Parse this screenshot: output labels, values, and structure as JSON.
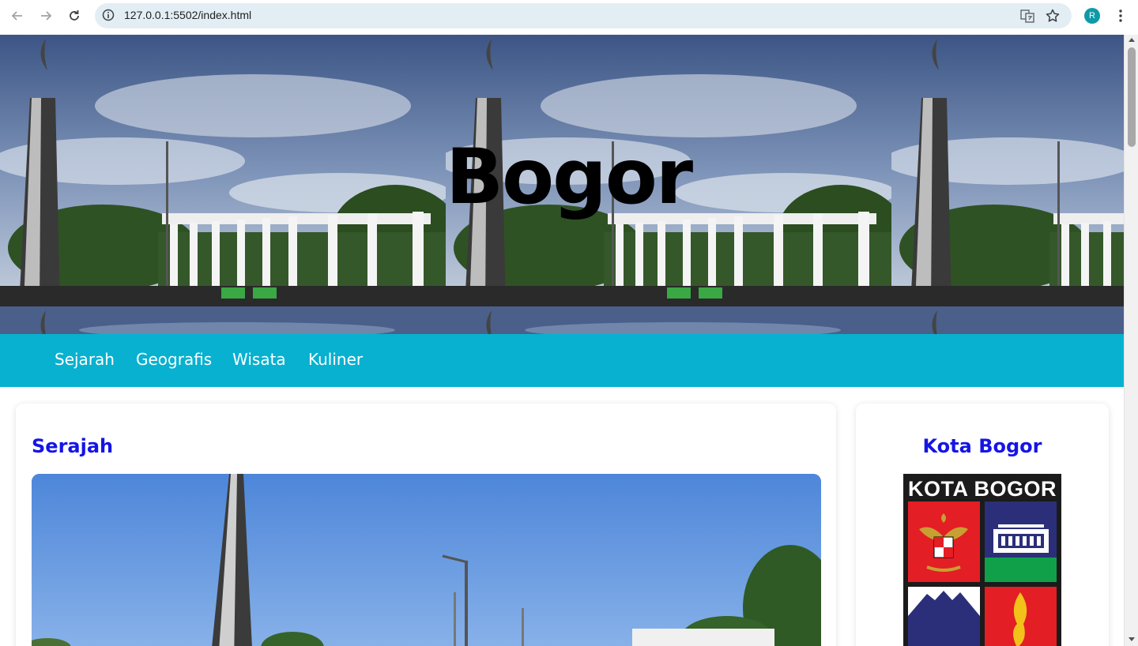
{
  "browser": {
    "url": "127.0.0.1:5502/index.html",
    "profile_initial": "R"
  },
  "hero": {
    "title": "Bogor"
  },
  "nav": {
    "items": [
      "Sejarah",
      "Geografis",
      "Wisata",
      "Kuliner"
    ]
  },
  "main_card": {
    "heading": "Serajah"
  },
  "side_card": {
    "heading": "Kota Bogor",
    "logo_text": "KOTA BOGOR"
  },
  "colors": {
    "nav_bg": "#08b1d0",
    "heading": "#1515e6",
    "profile": "#0e9aa7"
  }
}
